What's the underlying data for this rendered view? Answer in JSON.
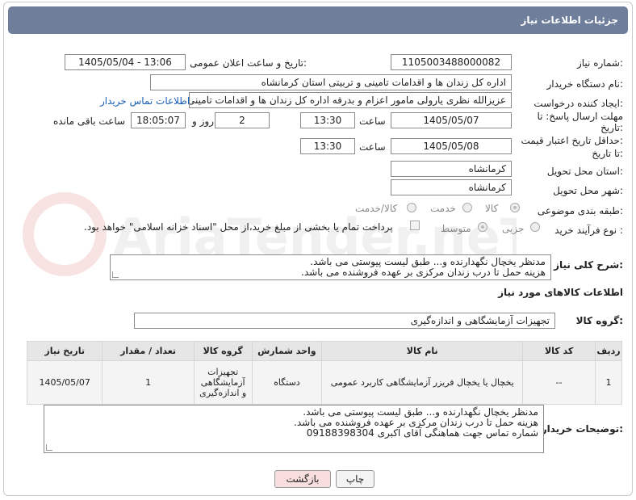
{
  "header": {
    "title": "جزئیات اطلاعات نیاز"
  },
  "fields": {
    "need_number_label": "شماره نیاز:",
    "need_number": "1105003488000082",
    "announce_label": "تاریخ و ساعت اعلان عمومی:",
    "announce_value": "1405/05/04 - 13:06",
    "buyer_label": "نام دستگاه خریدار:",
    "buyer_value": "اداره کل زندان ها و اقدامات تامینی و تربیتی استان کرمانشاه",
    "creator_label": "ایجاد کننده درخواست:",
    "creator_value": "عزیزالله نظری یارولی مامور اعزام و بدرقه اداره کل زندان ها و اقدامات تامینی و تربیتی",
    "contact_link": "اطلاعات تماس خریدار",
    "deadline_label_1": "مهلت ارسال پاسخ: تا",
    "deadline_label_2": "تاریخ:",
    "deadline_date": "1405/05/07",
    "time_label": "ساعت",
    "deadline_time": "13:30",
    "days_value": "2",
    "days_label": "روز و",
    "remaining_time": "18:05:07",
    "remaining_label": "ساعت باقی مانده",
    "validity_label_1": "حداقل تاریخ اعتبار قیمت:",
    "validity_label_2": "تا تاریخ:",
    "validity_date": "1405/05/08",
    "validity_time": "13:30",
    "province_label": "استان محل تحویل:",
    "province_value": "کرمانشاه",
    "city_label": "شهر محل تحویل:",
    "city_value": "کرمانشاه",
    "category_label": "طبقه بندی موضوعی:",
    "category_options": [
      "کالا",
      "خدمت",
      "کالا/خدمت"
    ],
    "process_label": "نوع فرآیند خرید :",
    "process_options": [
      "جزیی",
      "متوسط"
    ],
    "payment_note": "پرداخت تمام یا بخشی از مبلغ خرید،از محل \"اسناد خزانه اسلامی\" خواهد بود."
  },
  "description": {
    "label": "شرح کلی نیاز:",
    "lines": [
      "مدنظر یخچال نگهدارنده و... طبق لیست پیوستی  می باشد.",
      "هزینه حمل تا درب زندان مرکزی بر عهده فروشنده می باشد."
    ]
  },
  "goods_section": {
    "title": "اطلاعات کالاهای مورد نیاز",
    "group_label": "گروه کالا:",
    "group_value": "تجهیزات آزمایشگاهی و اندازه‌گیری"
  },
  "table": {
    "headers": [
      "ردیف",
      "کد کالا",
      "نام کالا",
      "واحد شمارش",
      "گروه کالا",
      "تعداد / مقدار",
      "تاریخ نیاز"
    ],
    "rows": [
      [
        "1",
        "--",
        "یخچال یا یخچال فریزر آزمایشگاهی کاربرد عمومی",
        "دستگاه",
        "تجهیزات آزمایشگاهی و اندازه‌گیری",
        "1",
        "1405/05/07"
      ]
    ]
  },
  "buyer_notes": {
    "label": "توضیحات خریدار:",
    "lines": [
      "مدنظر یخچال نگهدارنده و... طبق لیست پیوستی  می باشد.",
      "هزینه حمل تا درب زندان مرکزی بر عهده فروشنده می باشد.",
      "شماره تماس جهت هماهنگی آقای اکبری 09188398304"
    ]
  },
  "buttons": {
    "print": "چاپ",
    "back": "بازگشت"
  },
  "watermark": {
    "text": "AriaTender.neT"
  },
  "colors": {
    "title_bar": "#6f7f9b",
    "link": "#1a5fb4",
    "back_button": "#f9dede"
  }
}
